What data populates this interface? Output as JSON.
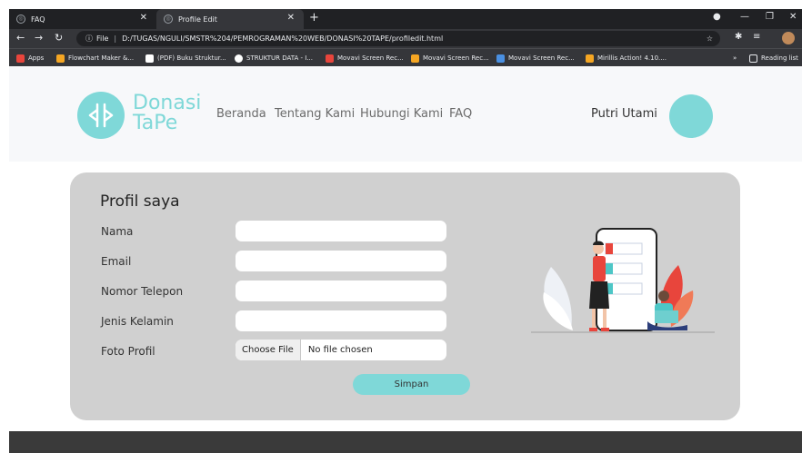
{
  "browser": {
    "tabs": [
      {
        "title": "FAQ"
      },
      {
        "title": "Profile Edit"
      }
    ],
    "url": {
      "scheme": "File",
      "path": "D:/TUGAS/NGULI/SMSTR%204/PEMROGRAMAN%20WEB/DONASI%20TAPE/profiledit.html"
    },
    "bookmarks": [
      {
        "label": "Apps",
        "color": "#e8453c"
      },
      {
        "label": "Flowchart Maker &...",
        "color": "#f5a623"
      },
      {
        "label": "(PDF) Buku Struktur...",
        "color": "#ffffff"
      },
      {
        "label": "STRUKTUR DATA - I...",
        "color": "#ffffff"
      },
      {
        "label": "Movavi Screen Rec...",
        "color": "#e8453c"
      },
      {
        "label": "Movavi Screen Rec...",
        "color": "#f5a623"
      },
      {
        "label": "Movavi Screen Rec...",
        "color": "#4a90e2"
      },
      {
        "label": "Mirillis Action! 4.10....",
        "color": "#f5a623"
      }
    ],
    "bookmarks_more": "»",
    "reading_list": "Reading list"
  },
  "header": {
    "logo_line1": "Donasi",
    "logo_line2": "TaPe",
    "nav": [
      "Beranda",
      "Tentang Kami",
      "Hubungi Kami",
      "FAQ"
    ],
    "username": "Putri Utami"
  },
  "form": {
    "title": "Profil saya",
    "fields": [
      {
        "label": "Nama",
        "value": ""
      },
      {
        "label": "Email",
        "value": ""
      },
      {
        "label": "Nomor Telepon",
        "value": ""
      },
      {
        "label": "Jenis Kelamin",
        "value": ""
      }
    ],
    "photo_label": "Foto Profil",
    "file_button": "Choose File",
    "file_status": "No file chosen",
    "submit": "Simpan"
  },
  "colors": {
    "accent": "#7fd8d8",
    "card": "#d0d0d0",
    "footer": "#3a3a3a"
  }
}
